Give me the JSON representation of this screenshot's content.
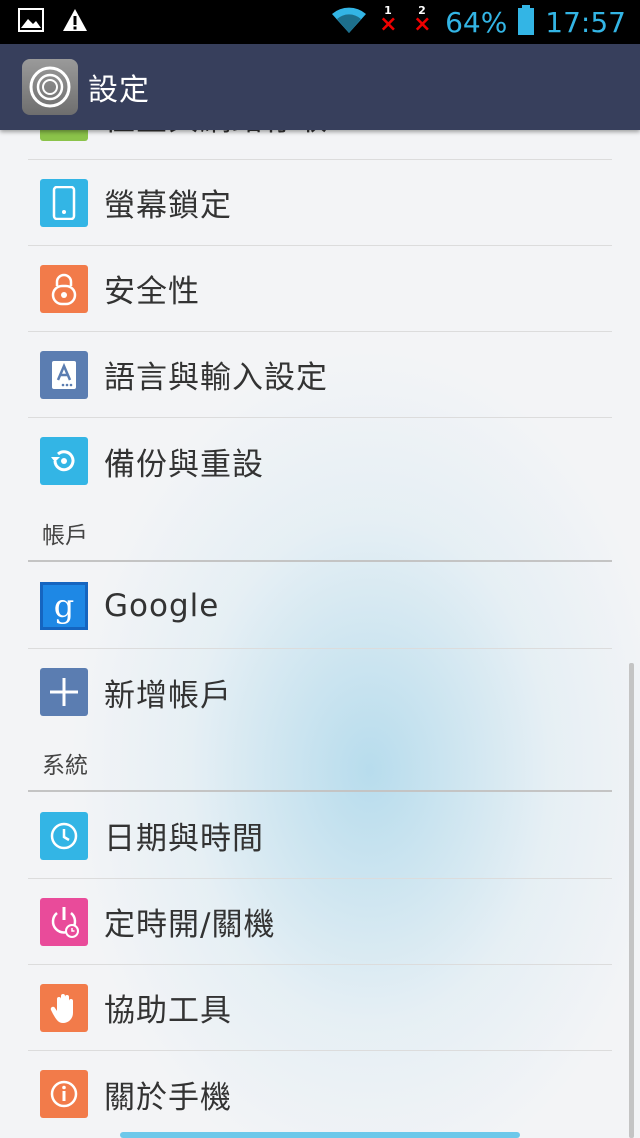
{
  "status_bar": {
    "battery_percent": "64%",
    "time": "17:57",
    "sim1": "1",
    "sim2": "2",
    "sim_no_signal": "×"
  },
  "action_bar": {
    "title": "設定"
  },
  "items_top": [
    {
      "label": "位置與網路存取",
      "icon": "location-icon",
      "color": "#8bc34a"
    },
    {
      "label": "螢幕鎖定",
      "icon": "phone-lock-icon",
      "color": "#33b5e5"
    },
    {
      "label": "安全性",
      "icon": "lock-icon",
      "color": "#f27b4a"
    },
    {
      "label": "語言與輸入設定",
      "icon": "language-icon",
      "color": "#5b7db1"
    },
    {
      "label": "備份與重設",
      "icon": "backup-icon",
      "color": "#33b5e5"
    }
  ],
  "sections": {
    "accounts": "帳戶",
    "system": "系統"
  },
  "account_items": [
    {
      "label": "Google",
      "icon": "google-icon",
      "color": "#1565c0"
    },
    {
      "label": "新增帳戶",
      "icon": "plus-icon",
      "color": "#5b7db1"
    }
  ],
  "system_items": [
    {
      "label": "日期與時間",
      "icon": "clock-icon",
      "color": "#33b5e5"
    },
    {
      "label": "定時開/關機",
      "icon": "power-timer-icon",
      "color": "#e94b9a"
    },
    {
      "label": "協助工具",
      "icon": "hand-icon",
      "color": "#f27b4a"
    },
    {
      "label": "關於手機",
      "icon": "info-icon",
      "color": "#f27b4a"
    }
  ]
}
